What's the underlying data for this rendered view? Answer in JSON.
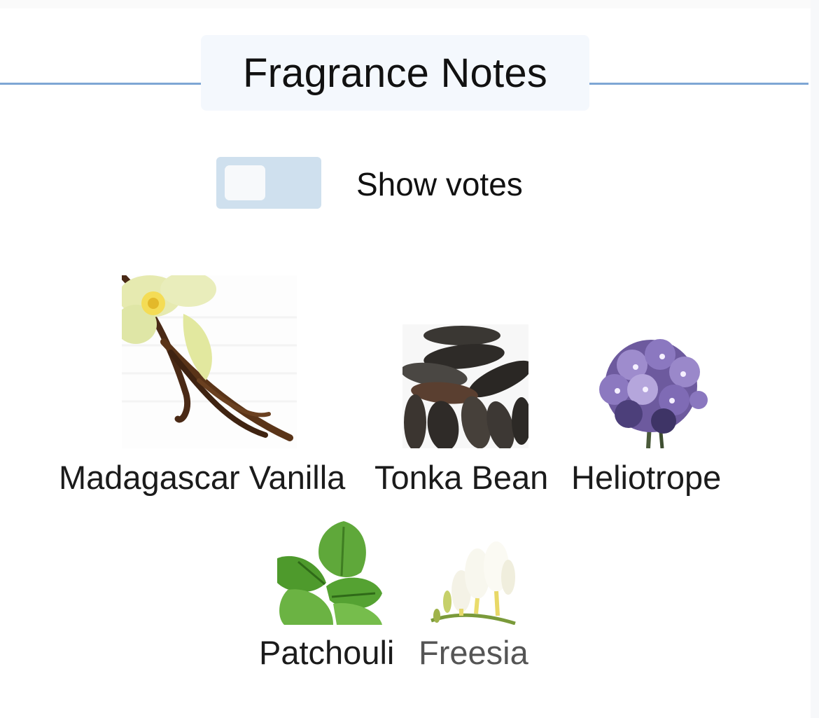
{
  "section": {
    "title": "Fragrance Notes"
  },
  "votes_toggle": {
    "label": "Show votes",
    "checked": false
  },
  "notes": [
    {
      "name": "Madagascar Vanilla",
      "icon": "vanilla-image"
    },
    {
      "name": "Tonka Bean",
      "icon": "tonka-bean-image"
    },
    {
      "name": "Heliotrope",
      "icon": "heliotrope-image"
    },
    {
      "name": "Patchouli",
      "icon": "patchouli-image"
    },
    {
      "name": "Freesia",
      "icon": "freesia-image"
    }
  ],
  "colors": {
    "divider": "#7ea6d4",
    "title_bg": "#f4f8fd",
    "toggle_bg": "#cfe0ee"
  }
}
